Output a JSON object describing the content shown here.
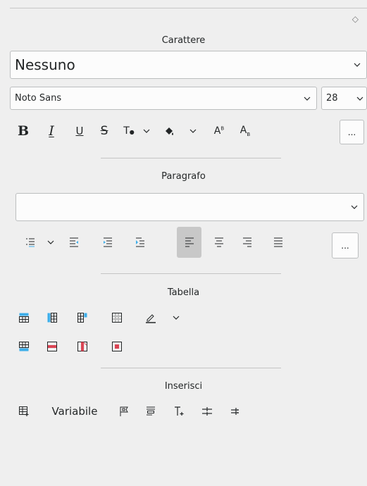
{
  "panel": {
    "corner_glyph": "◇",
    "character": {
      "title": "Carattere",
      "paragraph_style": "Nessuno",
      "font_name": "Noto Sans",
      "font_size": "28",
      "more_label": "..."
    },
    "paragraph": {
      "title": "Paragrafo",
      "style_value": "",
      "more_label": "..."
    },
    "table": {
      "title": "Tabella"
    },
    "insert": {
      "title": "Inserisci",
      "variable_label": "Variabile"
    }
  },
  "icons": {
    "bold": "B",
    "italic": "I",
    "underline": "U",
    "strike": "S",
    "superscript": "A",
    "subscript": "A",
    "text_transform": "T"
  },
  "colors": {
    "background": "#efefef",
    "field": "#fcfcfc",
    "border": "#bcbebf",
    "text": "#232627",
    "accent_blue": "#3daee9",
    "accent_red": "#da4453",
    "selected_bg": "#c8c8c8"
  }
}
